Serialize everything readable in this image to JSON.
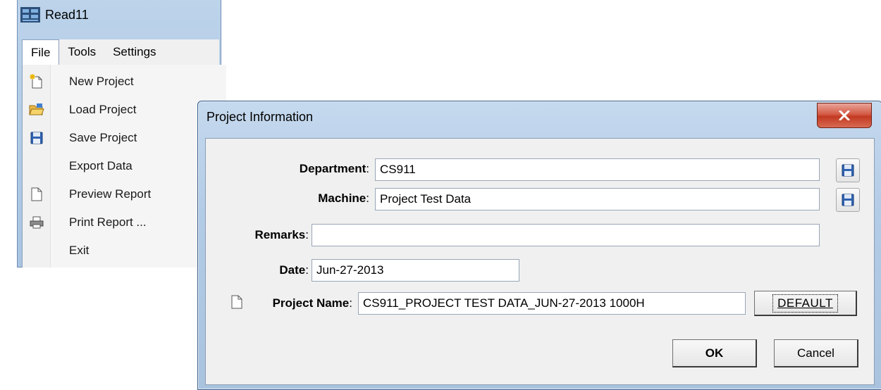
{
  "app": {
    "title": "Read11",
    "menu": [
      "File",
      "Tools",
      "Settings"
    ],
    "file_menu": [
      {
        "label": "New Project",
        "icon": "new-document-icon"
      },
      {
        "label": "Load Project",
        "icon": "open-folder-icon"
      },
      {
        "label": "Save Project",
        "icon": "floppy-disk-icon"
      },
      {
        "label": "Export Data",
        "icon": ""
      },
      {
        "label": "Preview Report",
        "icon": "document-icon"
      },
      {
        "label": "Print Report ...",
        "icon": "printer-icon"
      },
      {
        "label": "Exit",
        "icon": ""
      }
    ]
  },
  "dialog": {
    "title": "Project  Information",
    "department": {
      "label": "Department",
      "value": "CS911"
    },
    "machine": {
      "label": "Machine",
      "value": "Project Test Data"
    },
    "remarks": {
      "label": "Remarks",
      "value": ""
    },
    "date": {
      "label": "Date",
      "value": "Jun-27-2013"
    },
    "project_name": {
      "label": "Project Name",
      "value": "CS911_PROJECT TEST DATA_JUN-27-2013 1000H"
    },
    "default_button": "DEFAULT",
    "ok_button": "OK",
    "cancel_button": "Cancel"
  },
  "colors": {
    "title_blue": "#b2cbe6",
    "close_red": "#c23a22",
    "client_gray": "#f0f0f0"
  }
}
